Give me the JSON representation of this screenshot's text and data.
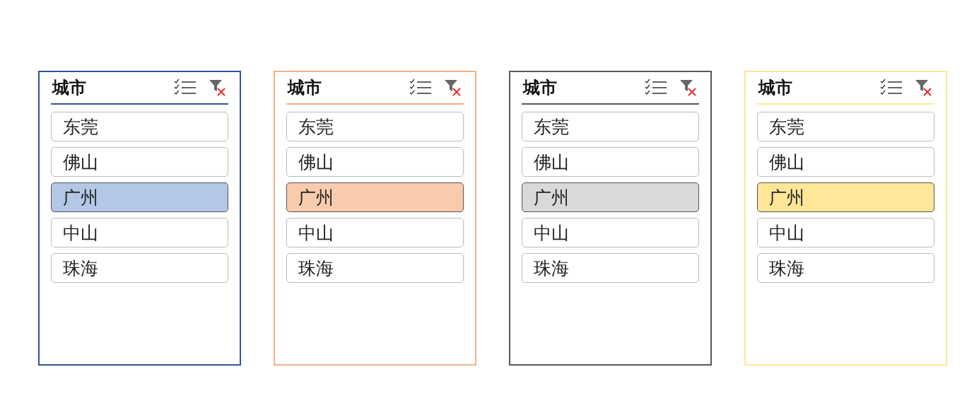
{
  "slicers": [
    {
      "title": "城市",
      "color": "#2f5597",
      "items": [
        {
          "label": "东莞",
          "selected": false,
          "color": "#ffffff"
        },
        {
          "label": "佛山",
          "selected": false,
          "color": "#ffffff"
        },
        {
          "label": "广州",
          "selected": true,
          "color": "#b4c7e7"
        },
        {
          "label": "中山",
          "selected": false,
          "color": "#ffffff"
        },
        {
          "label": "珠海",
          "selected": false,
          "color": "#ffffff"
        }
      ]
    },
    {
      "title": "城市",
      "color": "#f4b183",
      "items": [
        {
          "label": "东莞",
          "selected": false,
          "color": "#ffffff"
        },
        {
          "label": "佛山",
          "selected": false,
          "color": "#ffffff"
        },
        {
          "label": "广州",
          "selected": true,
          "color": "#f8cbad"
        },
        {
          "label": "中山",
          "selected": false,
          "color": "#ffffff"
        },
        {
          "label": "珠海",
          "selected": false,
          "color": "#ffffff"
        }
      ]
    },
    {
      "title": "城市",
      "color": "#595959",
      "items": [
        {
          "label": "东莞",
          "selected": false,
          "color": "#ffffff"
        },
        {
          "label": "佛山",
          "selected": false,
          "color": "#ffffff"
        },
        {
          "label": "广州",
          "selected": true,
          "color": "#d9d9d9"
        },
        {
          "label": "中山",
          "selected": false,
          "color": "#ffffff"
        },
        {
          "label": "珠海",
          "selected": false,
          "color": "#ffffff"
        }
      ]
    },
    {
      "title": "城市",
      "color": "#ffe699",
      "items": [
        {
          "label": "东莞",
          "selected": false,
          "color": "#ffffff"
        },
        {
          "label": "佛山",
          "selected": false,
          "color": "#ffffff"
        },
        {
          "label": "广州",
          "selected": true,
          "color": "#ffe699"
        },
        {
          "label": "中山",
          "selected": false,
          "color": "#ffffff"
        },
        {
          "label": "珠海",
          "selected": false,
          "color": "#ffffff"
        }
      ]
    }
  ]
}
